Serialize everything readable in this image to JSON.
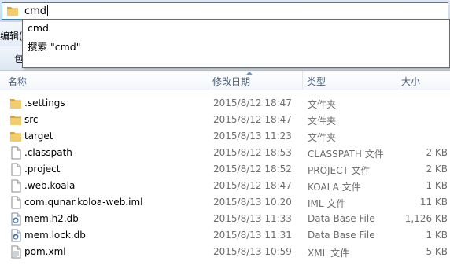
{
  "address_bar": {
    "value": "cmd"
  },
  "menubar": {
    "edit_label": "编辑(E)"
  },
  "toolbar": {
    "include_label": "包"
  },
  "autocomplete": {
    "items": [
      {
        "label": "cmd"
      },
      {
        "label": "搜索 \"cmd\""
      }
    ]
  },
  "columns": {
    "name": "名称",
    "date": "修改日期",
    "type": "类型",
    "size": "大小"
  },
  "files": [
    {
      "name": ".settings",
      "date": "2015/8/12 18:47",
      "type": "文件夹",
      "size": "",
      "icon": "folder-icon"
    },
    {
      "name": "src",
      "date": "2015/8/12 18:47",
      "type": "文件夹",
      "size": "",
      "icon": "folder-icon"
    },
    {
      "name": "target",
      "date": "2015/8/13 11:23",
      "type": "文件夹",
      "size": "",
      "icon": "folder-icon"
    },
    {
      "name": ".classpath",
      "date": "2015/8/12 18:53",
      "type": "CLASSPATH 文件",
      "size": "2 KB",
      "icon": "file-icon"
    },
    {
      "name": ".project",
      "date": "2015/8/12 18:52",
      "type": "PROJECT 文件",
      "size": "2 KB",
      "icon": "file-icon"
    },
    {
      "name": ".web.koala",
      "date": "2015/8/12 18:47",
      "type": "KOALA 文件",
      "size": "1 KB",
      "icon": "file-icon"
    },
    {
      "name": "com.qunar.koloa-web.iml",
      "date": "2015/8/13 10:20",
      "type": "IML 文件",
      "size": "11 KB",
      "icon": "file-icon"
    },
    {
      "name": "mem.h2.db",
      "date": "2015/8/13 11:33",
      "type": "Data Base File",
      "size": "1,126 KB",
      "icon": "database-file-icon"
    },
    {
      "name": "mem.lock.db",
      "date": "2015/8/13 11:31",
      "type": "Data Base File",
      "size": "1 KB",
      "icon": "database-file-icon"
    },
    {
      "name": "pom.xml",
      "date": "2015/8/13 10:59",
      "type": "XML 文件",
      "size": "5 KB",
      "icon": "document-icon"
    }
  ],
  "colors": {
    "folder": "#e8b84a",
    "selection_border": "#3c7fb1"
  }
}
